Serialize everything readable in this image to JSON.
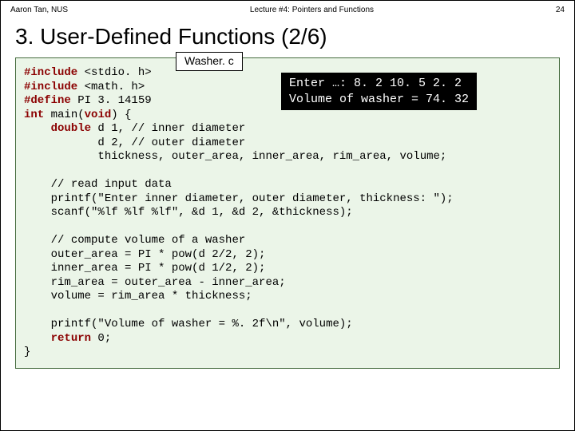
{
  "header": {
    "left": "Aaron Tan, NUS",
    "center": "Lecture #4: Pointers and Functions",
    "right": "24"
  },
  "title": "3. User-Defined Functions (2/6)",
  "filename": "Washer. c",
  "output": {
    "line1_label": "Enter …: ",
    "line1_input": "8. 2 10. 5 2. 2",
    "line2": "Volume of washer = 74. 32"
  },
  "code": {
    "kw_include": "#include",
    "inc1": " <stdio. h>",
    "inc2": " <math. h>",
    "kw_define": "#define",
    "def1": " PI 3. 14159",
    "kw_int": "int",
    "main_sig1": " main(",
    "kw_void": "void",
    "main_sig2": ") {",
    "indent1": "    ",
    "kw_double": "double",
    "decl1": " d 1, // inner diameter",
    "decl_pad": "           ",
    "decl2": "d 2, // outer diameter",
    "decl3": "thickness, outer_area, inner_area, rim_area, volume;",
    "c1": "// read input data",
    "c2": "printf(\"Enter inner diameter, outer diameter, thickness: \");",
    "c3": "scanf(\"%lf %lf %lf\", &d 1, &d 2, &thickness);",
    "c4": "// compute volume of a washer",
    "c5": "outer_area = PI * pow(d 2/2, 2);",
    "c6": "inner_area = PI * pow(d 1/2, 2);",
    "c7": "rim_area = outer_area - inner_area;",
    "c8": "volume = rim_area * thickness;",
    "c9": "printf(\"Volume of washer = %. 2f\\n\", volume);",
    "kw_return": "return",
    "ret_tail": " 0;",
    "close": "}"
  }
}
